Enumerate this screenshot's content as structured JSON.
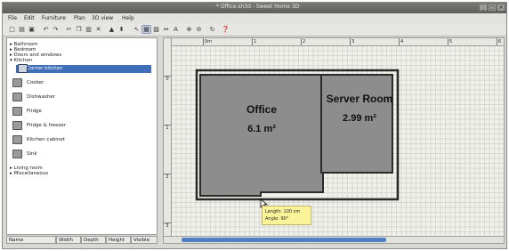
{
  "window": {
    "title": "* Office.sh3d - Sweet Home 3D",
    "controls": [
      "_",
      "□",
      "×"
    ]
  },
  "menubar": [
    "File",
    "Edit",
    "Furniture",
    "Plan",
    "3D view",
    "Help"
  ],
  "toolbar": {
    "icons": [
      "new-icon",
      "open-icon",
      "save-icon",
      "undo-icon",
      "redo-icon",
      "cut-icon",
      "copy-icon",
      "paste-icon",
      "delete-icon",
      "add-furniture-icon",
      "import-icon",
      "select-icon",
      "create-walls-icon",
      "create-rooms-icon",
      "create-dimensions-icon",
      "add-text-icon",
      "zoom-in-icon",
      "zoom-out-icon",
      "rotate-icon",
      "help-icon"
    ],
    "selected": "create-rooms-icon"
  },
  "catalog": {
    "categories_top": [
      "Bathroom",
      "Bedroom",
      "Doors and windows",
      "Kitchen"
    ],
    "items": [
      {
        "label": "Corner kitchen",
        "icon": "kitchen-cabinet-icon",
        "selected": true
      },
      {
        "label": "Cooker",
        "icon": "cooker-icon",
        "selected": false
      },
      {
        "label": "Dishwasher",
        "icon": "dishwasher-icon",
        "selected": false
      },
      {
        "label": "Fridge",
        "icon": "fridge-icon",
        "selected": false
      },
      {
        "label": "Fridge & freezer",
        "icon": "fridge-freezer-icon",
        "selected": false
      },
      {
        "label": "Kitchen cabinet",
        "icon": "kitchen-cabinet-icon",
        "selected": false
      },
      {
        "label": "Sink",
        "icon": "sink-icon",
        "selected": false
      }
    ],
    "categories_bottom": [
      "Living room",
      "Miscellaneous"
    ]
  },
  "furniture_table": {
    "columns": [
      "Name",
      "Width",
      "Depth",
      "Height",
      "Visible"
    ]
  },
  "plan": {
    "ruler_h": [
      "0m",
      "1",
      "2",
      "3",
      "4",
      "5",
      "6"
    ],
    "ruler_v": [
      "0",
      "1",
      "2",
      "3"
    ],
    "rooms": [
      {
        "name": "Office",
        "area": "6.1 m²"
      },
      {
        "name": "Server Room",
        "area": "2.99 m²"
      }
    ],
    "tooltip": {
      "length": "Length: 100 cm",
      "angle": "Angle: 90°"
    }
  }
}
